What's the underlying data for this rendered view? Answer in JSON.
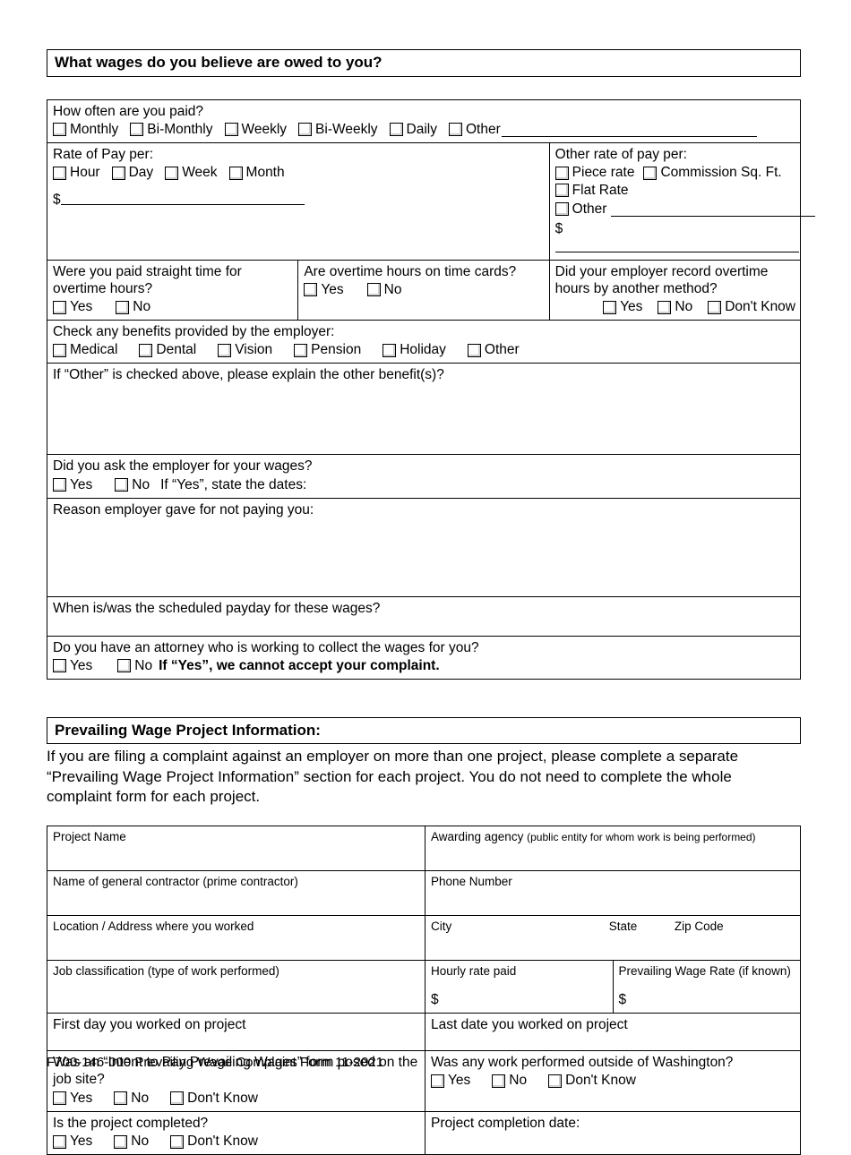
{
  "sections": {
    "wages": {
      "heading": "What wages do you believe are owed to you?",
      "pay_frequency": {
        "question": "How often are you paid?",
        "options": [
          "Monthly",
          "Bi-Monthly",
          "Weekly",
          "Bi-Weekly",
          "Daily",
          "Other"
        ],
        "other_has_blank": true
      },
      "rate_of_pay": {
        "label": "Rate of Pay per:",
        "options": [
          "Hour",
          "Day",
          "Week",
          "Month"
        ],
        "amount_prefix": "$"
      },
      "other_rate_of_pay": {
        "label": "Other rate of pay per:",
        "options": [
          "Piece rate",
          "Commission Sq. Ft.",
          "Flat Rate",
          "Other"
        ],
        "amount_prefix": "$"
      },
      "straight_time": {
        "question": "Were you paid straight time for overtime hours?",
        "options": [
          "Yes",
          "No"
        ]
      },
      "overtime_timecards": {
        "question": "Are overtime hours on time cards?",
        "options": [
          "Yes",
          "No"
        ]
      },
      "overtime_other_method": {
        "question": "Did your employer record overtime hours by another method?",
        "options": [
          "Yes",
          "No",
          "Don't Know"
        ]
      },
      "benefits": {
        "question": "Check any benefits provided by the employer:",
        "options": [
          "Medical",
          "Dental",
          "Vision",
          "Pension",
          "Holiday",
          "Other"
        ]
      },
      "benefits_other_explain": {
        "question": "If “Other” is checked above, please explain the other benefit(s)?"
      },
      "asked_employer": {
        "question": "Did you ask the employer for your wages?",
        "options": [
          "Yes",
          "No"
        ],
        "followup": "If “Yes”, state the dates:"
      },
      "reason_not_paid": {
        "question": "Reason employer gave for not paying you:"
      },
      "scheduled_payday": {
        "question": "When is/was the scheduled payday for these wages?"
      },
      "attorney": {
        "question": "Do you have an attorney who is working to collect the wages for you?",
        "options": [
          "Yes",
          "No"
        ],
        "warning": "If “Yes”, we cannot accept your complaint."
      }
    },
    "prevailing_wage": {
      "heading": "Prevailing Wage Project Information:",
      "intro": "If you are filing a complaint against an employer on more than one project, please complete a separate “Prevailing Wage Project Information” section for each project.  You do not need to complete the whole complaint form for each project.",
      "fields": {
        "project_name": "Project Name",
        "awarding_agency": "Awarding agency",
        "awarding_agency_hint": "(public entity for whom work is being performed)",
        "general_contractor": "Name of general contractor (prime contractor)",
        "phone_number": "Phone Number",
        "location_address": "Location / Address where you worked",
        "city": "City",
        "state": "State",
        "zip_code": "Zip Code",
        "job_classification": "Job classification (type of work performed)",
        "hourly_rate_paid": "Hourly rate paid",
        "prevailing_wage_rate": "Prevailing Wage Rate (if known)",
        "currency_prefix": "$",
        "first_day": "First day you worked on project",
        "last_date": "Last date you worked on project",
        "intent_posted": "Was an “Intent to Pay Prevailing Wages” form posed on the job site?",
        "intent_posted_options": [
          "Yes",
          "No",
          "Don't Know"
        ],
        "outside_washington": "Was any work performed outside of Washington?",
        "outside_washington_options": [
          "Yes",
          "No",
          "Don't Know"
        ],
        "project_completed": "Is the project completed?",
        "project_completed_options": [
          "Yes",
          "No",
          "Don't Know"
        ],
        "completion_date": "Project completion date:"
      }
    }
  },
  "footer": {
    "text": "F700-146-000 Prevailing Wage Complaint Form  11-2021"
  }
}
